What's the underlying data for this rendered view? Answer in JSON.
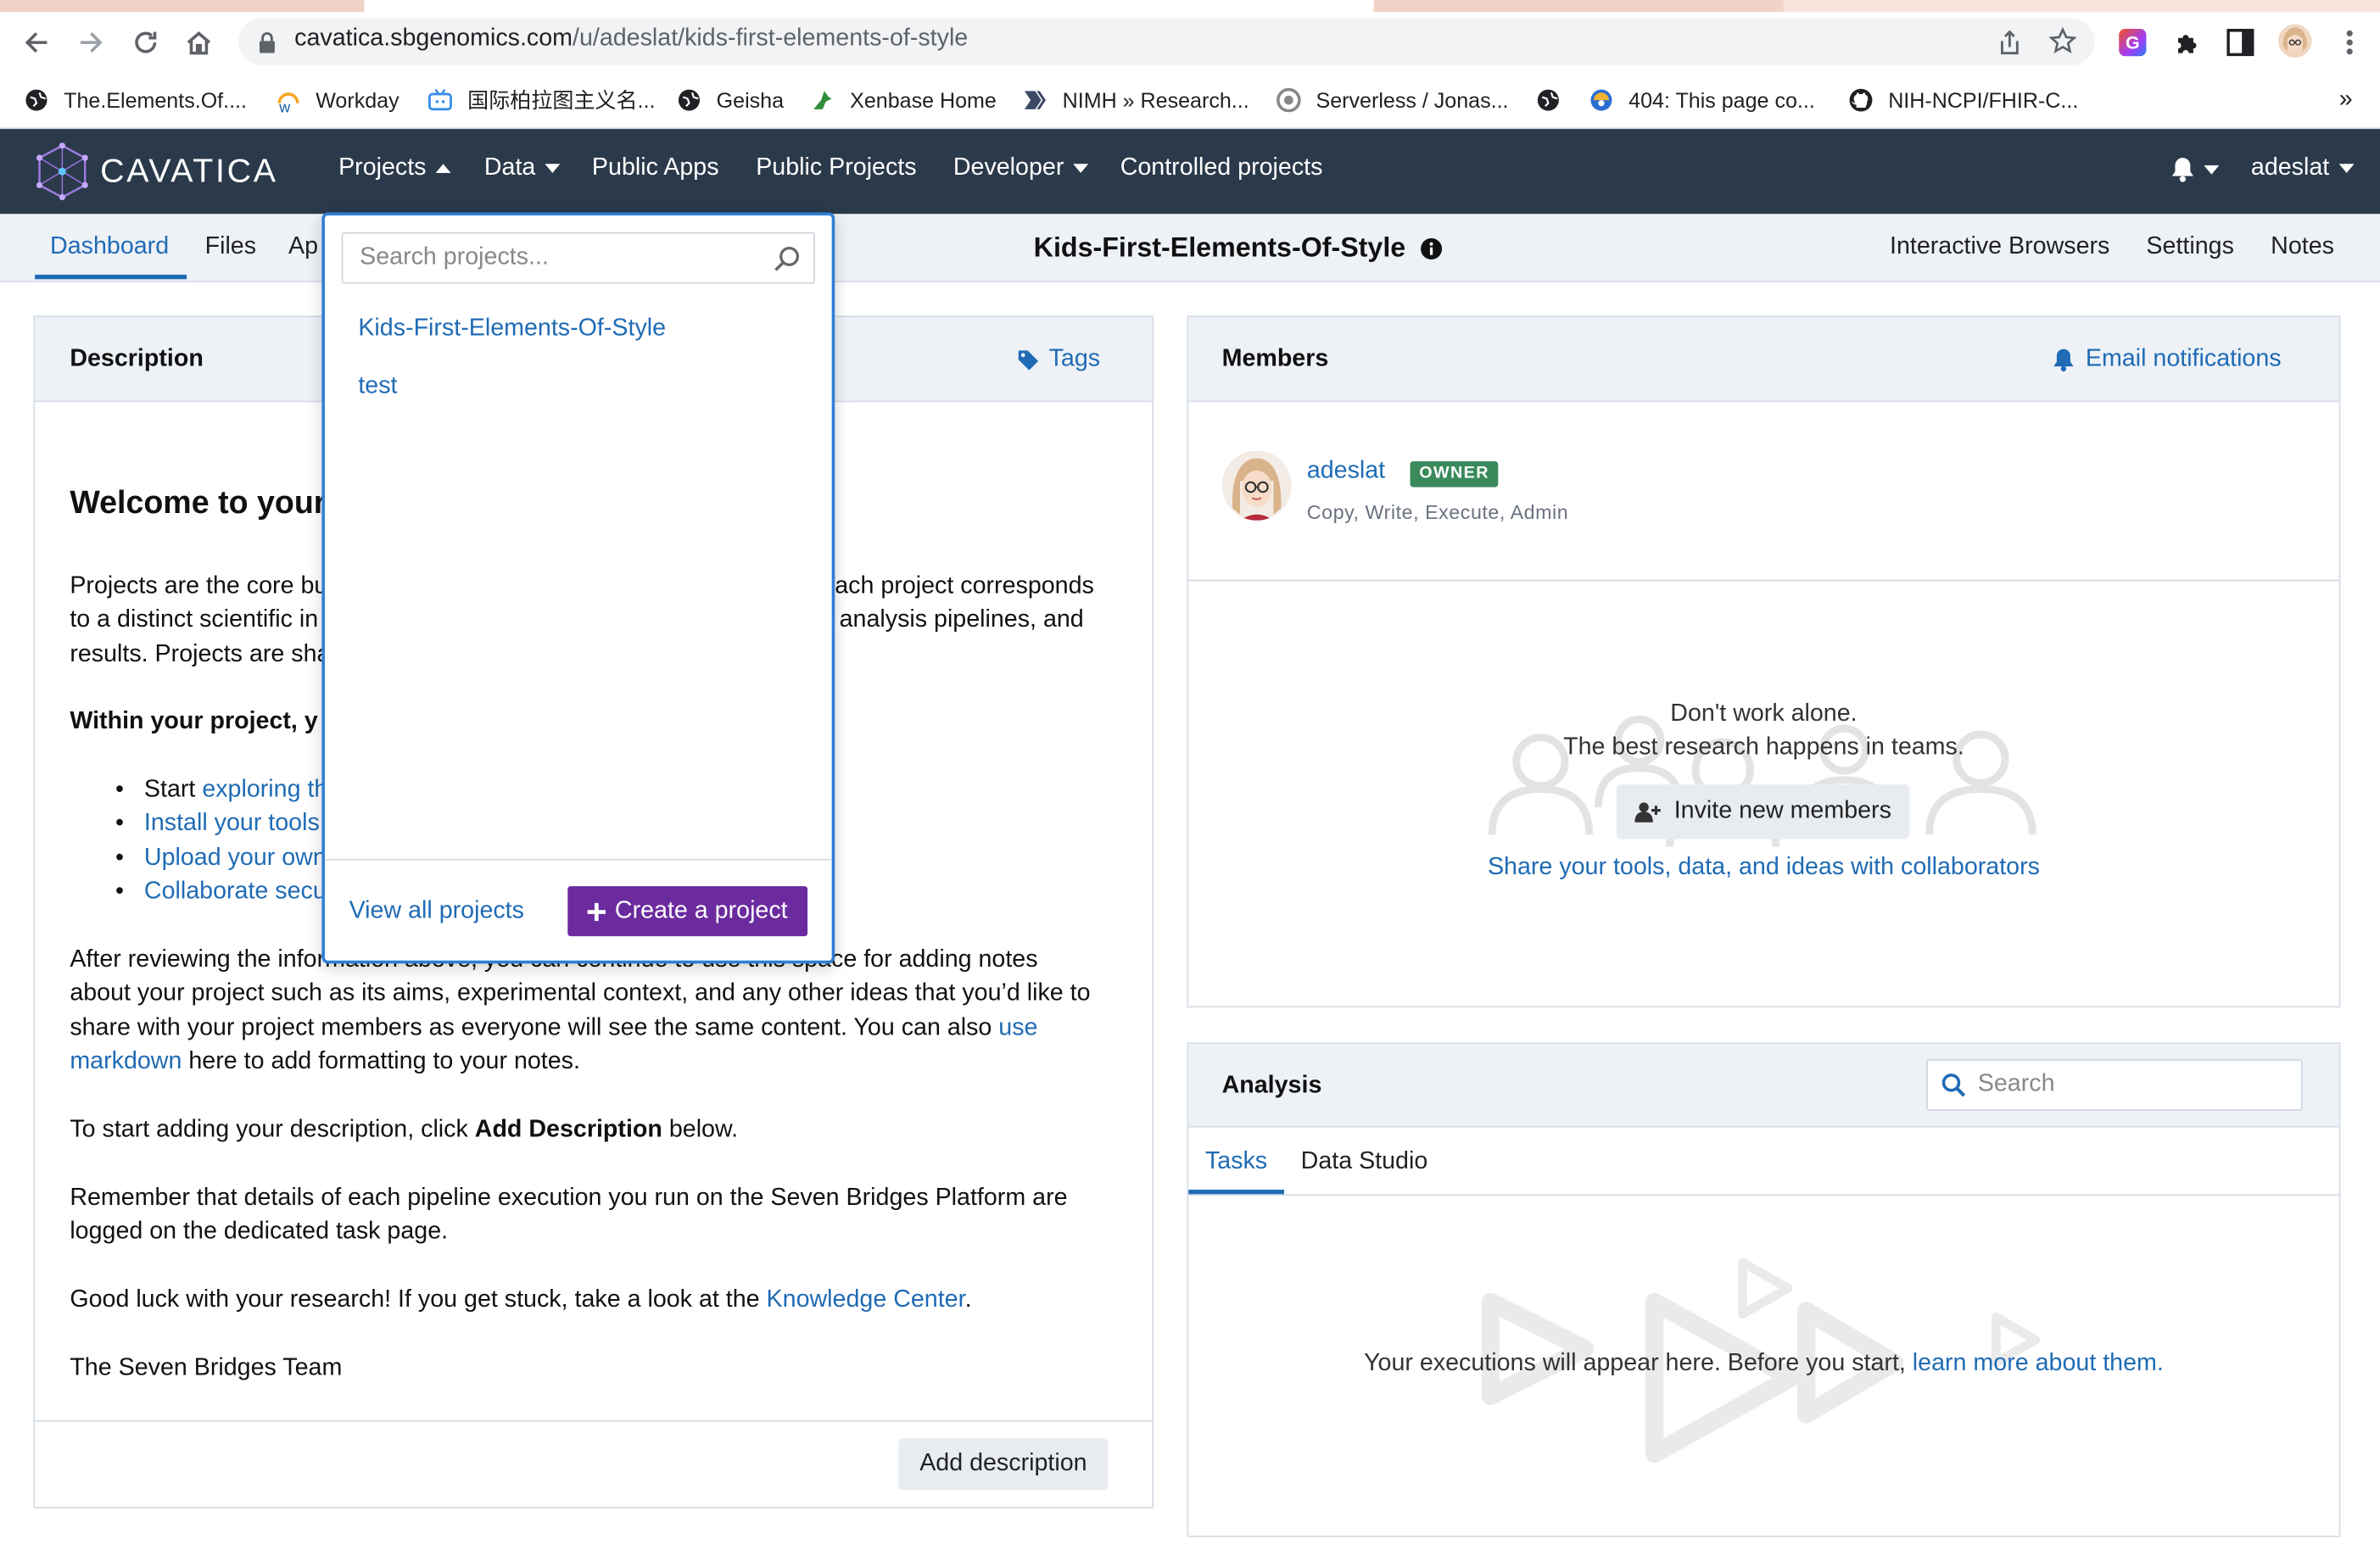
{
  "browser": {
    "url_domain": "cavatica.sbgenomics.com",
    "url_path": "/u/adeslat/kids-first-elements-of-style",
    "bookmarks": [
      {
        "label": "The.Elements.Of...."
      },
      {
        "label": "Workday"
      },
      {
        "label": "国际柏拉图主义名..."
      },
      {
        "label": "Geisha"
      },
      {
        "label": "Xenbase Home"
      },
      {
        "label": "NIMH » Research..."
      },
      {
        "label": "Serverless / Jonas..."
      },
      {
        "label": "404: This page co..."
      },
      {
        "label": "NIH-NCPI/FHIR-C..."
      }
    ],
    "more_bookmarks": "»"
  },
  "nav": {
    "logo_text": "CAVATICA",
    "items": [
      "Projects",
      "Data",
      "Public Apps",
      "Public Projects",
      "Developer",
      "Controlled projects"
    ],
    "user": "adeslat"
  },
  "subnav": {
    "tabs": [
      "Dashboard",
      "Files",
      "Ap"
    ],
    "project_title": "Kids-First-Elements-Of-Style",
    "right_links": [
      "Interactive Browsers",
      "Settings",
      "Notes"
    ]
  },
  "description": {
    "title": "Description",
    "tags": "Tags",
    "welcome": "Welcome to your",
    "p1_l1a": "Projects are the core bu",
    "p1_l1b": "ach project corresponds",
    "p1_l2a": "to a distinct scientific in",
    "p1_l2b": "analysis pipelines, and",
    "p1_l3": "results. Projects are sha",
    "within": "Within your project, y",
    "bullet_start": "Start ",
    "bullets": [
      "exploring th",
      "Install your tools",
      "Upload your own",
      "Collaborate secu"
    ],
    "after_l1": "After reviewing the information above, you can continue to use this space for adding notes",
    "after_l2": "about your project such as its aims, experimental context, and any other ideas that you’d like to",
    "after_l3": "share with your project members as everyone will see the same content. You can also ",
    "use_link": "use",
    "markdown_link": "markdown",
    "after_l4": " here to add formatting to your notes.",
    "to_start_a": "To start adding your description, click ",
    "to_start_b": "Add Description",
    "to_start_c": " below.",
    "remember_l1": "Remember that details of each pipeline execution you run on the Seven Bridges Platform are",
    "remember_l2": "logged on the dedicated task page.",
    "good_luck": "Good luck with your research! If you get stuck, take a look at the ",
    "knowledge_center": "Knowledge Center",
    "period": ".",
    "sign": "The Seven Bridges Team",
    "add_button": "Add description"
  },
  "members": {
    "title": "Members",
    "email_notifications": "Email notifications",
    "member_name": "adeslat",
    "badge": "OWNER",
    "permissions": "Copy, Write, Execute, Admin",
    "empty_l1": "Don't work alone.",
    "empty_l2": "The best research happens in teams.",
    "invite": "Invite new members",
    "share": "Share your tools, data, and ideas with collaborators"
  },
  "analysis": {
    "title": "Analysis",
    "search_placeholder": "Search",
    "tabs": [
      "Tasks",
      "Data Studio"
    ],
    "empty_a": "Your executions will appear here. Before you start, ",
    "empty_link": "learn more about them."
  },
  "dropdown": {
    "search_placeholder": "Search projects...",
    "projects": [
      "Kids-First-Elements-Of-Style",
      "test"
    ],
    "view_all": "View all projects",
    "create": "Create a project"
  },
  "colors": {
    "nav_bg": "#2b3a4a",
    "link": "#1f6bb5",
    "owner_badge": "#3a8a5c",
    "create_btn": "#6b2a9e"
  }
}
